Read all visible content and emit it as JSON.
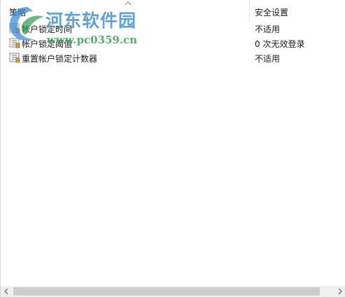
{
  "columns": {
    "policy": "策略",
    "security_setting": "安全设置"
  },
  "rows": [
    {
      "policy": "帐户锁定时间",
      "setting": "不适用",
      "icon": "policy-icon"
    },
    {
      "policy": "帐户锁定阈值",
      "setting": "0 次无效登录",
      "icon": "policy-icon"
    },
    {
      "policy": "重置帐户锁定计数器",
      "setting": "不适用",
      "icon": "policy-icon"
    }
  ],
  "watermark": {
    "title": "河东软件园",
    "url": "www.pc0359.cn"
  },
  "colors": {
    "watermark_title": "#3b8ed4",
    "watermark_url": "#2e9a4a",
    "scrollbar_thumb": "#cdcdcd",
    "scrollbar_track": "#f0f0f0"
  }
}
